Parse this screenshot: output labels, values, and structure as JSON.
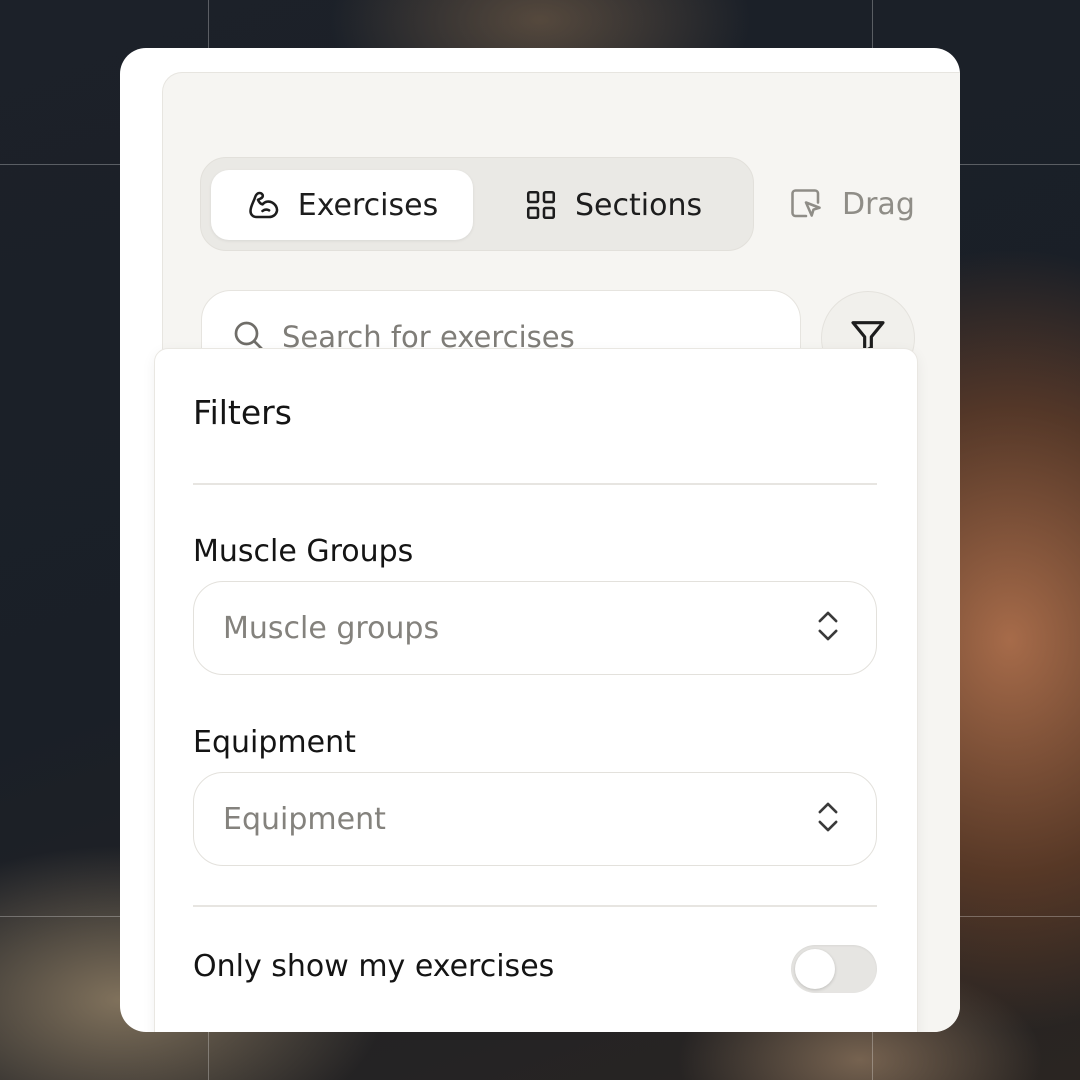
{
  "tabs": [
    {
      "label": "Exercises",
      "icon": "flexed-arm-icon",
      "active": true
    },
    {
      "label": "Sections",
      "icon": "grid-icon",
      "active": false
    }
  ],
  "drag": {
    "label": "Drag",
    "icon": "drag-cursor-icon"
  },
  "search": {
    "placeholder": "Search for exercises",
    "icon": "search-icon"
  },
  "filter_button": {
    "icon": "filter-icon"
  },
  "filters": {
    "title": "Filters",
    "muscle_groups": {
      "label": "Muscle Groups",
      "value": "Muscle groups"
    },
    "equipment": {
      "label": "Equipment",
      "value": "Equipment"
    },
    "only_mine": {
      "label": "Only show my exercises",
      "enabled": false
    }
  }
}
